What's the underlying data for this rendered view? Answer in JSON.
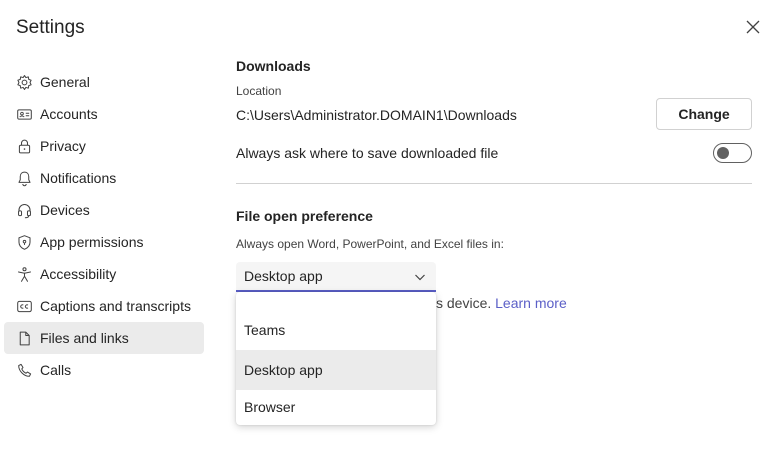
{
  "app": {
    "title": "Settings"
  },
  "sidebar": {
    "items": [
      {
        "label": "General",
        "icon": "gear-icon"
      },
      {
        "label": "Accounts",
        "icon": "id-card-icon"
      },
      {
        "label": "Privacy",
        "icon": "lock-icon"
      },
      {
        "label": "Notifications",
        "icon": "bell-icon"
      },
      {
        "label": "Devices",
        "icon": "headset-icon"
      },
      {
        "label": "App permissions",
        "icon": "shield-icon"
      },
      {
        "label": "Accessibility",
        "icon": "accessibility-icon"
      },
      {
        "label": "Captions and transcripts",
        "icon": "closed-captions-icon"
      },
      {
        "label": "Files and links",
        "icon": "document-icon",
        "active": true
      },
      {
        "label": "Calls",
        "icon": "phone-icon"
      }
    ]
  },
  "downloads": {
    "title": "Downloads",
    "location_label": "Location",
    "path": "C:\\Users\\Administrator.DOMAIN1\\Downloads",
    "change_label": "Change",
    "ask_label": "Always ask where to save downloaded file",
    "ask_enabled": false
  },
  "file_open": {
    "title": "File open preference",
    "description": "Always open Word, PowerPoint, and Excel files in:",
    "selected": "Desktop app",
    "helper_text": "s device.",
    "learn_more": "Learn more",
    "options": [
      {
        "label": "Teams"
      },
      {
        "label": "Desktop app",
        "selected": true
      },
      {
        "label": "Browser"
      }
    ]
  },
  "colors": {
    "accent": "#5b5fc7",
    "selected_bg": "#ebebeb"
  }
}
